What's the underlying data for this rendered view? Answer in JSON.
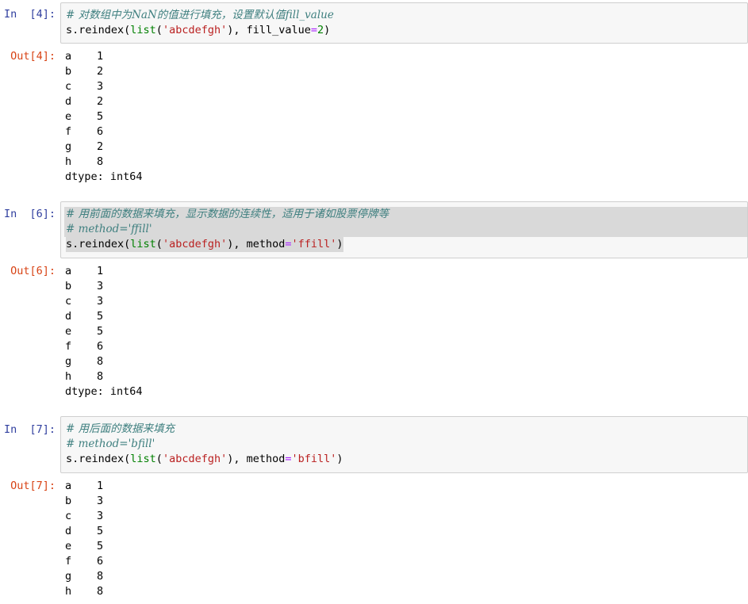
{
  "cells": [
    {
      "in_prompt": "In  [4]:",
      "code_lines": [
        {
          "comment": "# 对数组中为NaN的值进行填充，设置默认值fill_value"
        },
        {
          "obj": "s.reindex(",
          "fn": "list",
          "p1": "(",
          "str": "'abcdefgh'",
          "p2": "), ",
          "kw": "fill_value",
          "eq": "=",
          "val": "2",
          "end": ")"
        }
      ],
      "out_prompt": "Out[4]:",
      "output_rows": [
        {
          "key": "a",
          "val": "1"
        },
        {
          "key": "b",
          "val": "2"
        },
        {
          "key": "c",
          "val": "3"
        },
        {
          "key": "d",
          "val": "2"
        },
        {
          "key": "e",
          "val": "5"
        },
        {
          "key": "f",
          "val": "6"
        },
        {
          "key": "g",
          "val": "2"
        },
        {
          "key": "h",
          "val": "8"
        }
      ],
      "dtype": "dtype: int64"
    },
    {
      "in_prompt": "In  [6]:",
      "code_lines": [
        {
          "comment": "# 用前面的数据来填充，显示数据的连续性，适用于诸如股票停牌等"
        },
        {
          "comment": "# method='ffill'"
        },
        {
          "obj": "s.reindex(",
          "fn": "list",
          "p1": "(",
          "str": "'abcdefgh'",
          "p2": "), method",
          "eq": "=",
          "val": "'ffill'",
          "end": ")"
        }
      ],
      "out_prompt": "Out[6]:",
      "output_rows": [
        {
          "key": "a",
          "val": "1"
        },
        {
          "key": "b",
          "val": "3"
        },
        {
          "key": "c",
          "val": "3"
        },
        {
          "key": "d",
          "val": "5"
        },
        {
          "key": "e",
          "val": "5"
        },
        {
          "key": "f",
          "val": "6"
        },
        {
          "key": "g",
          "val": "8"
        },
        {
          "key": "h",
          "val": "8"
        }
      ],
      "dtype": "dtype: int64"
    },
    {
      "in_prompt": "In  [7]:",
      "code_lines": [
        {
          "comment": "# 用后面的数据来填充"
        },
        {
          "comment": "# method='bfill'"
        },
        {
          "obj": "s.reindex(",
          "fn": "list",
          "p1": "(",
          "str": "'abcdefgh'",
          "p2": "), method",
          "eq": "=",
          "val": "'bfill'",
          "end": ")"
        }
      ],
      "out_prompt": "Out[7]:",
      "output_rows": [
        {
          "key": "a",
          "val": "1"
        },
        {
          "key": "b",
          "val": "3"
        },
        {
          "key": "c",
          "val": "3"
        },
        {
          "key": "d",
          "val": "5"
        },
        {
          "key": "e",
          "val": "5"
        },
        {
          "key": "f",
          "val": "6"
        },
        {
          "key": "g",
          "val": "8"
        },
        {
          "key": "h",
          "val": "8"
        }
      ]
    }
  ]
}
